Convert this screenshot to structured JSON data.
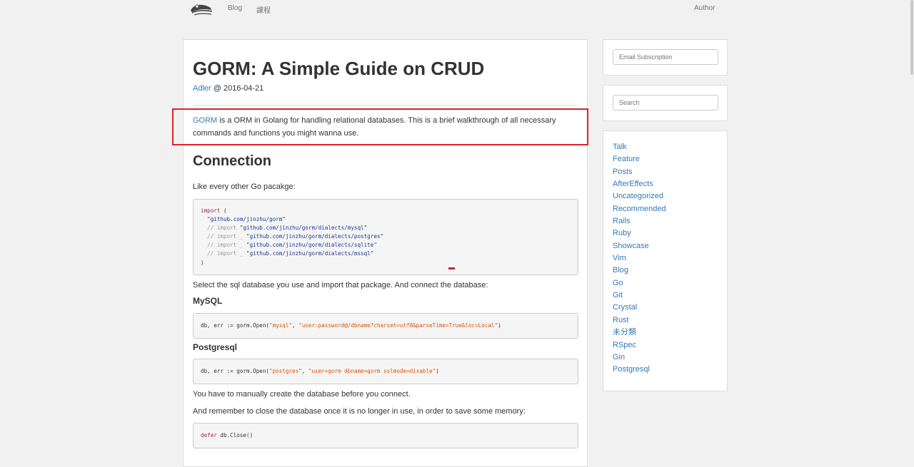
{
  "nav": {
    "logo": "logo-icon",
    "links": [
      "Blog",
      "課程"
    ],
    "author": "Author"
  },
  "post": {
    "title": "GORM: A Simple Guide on CRUD",
    "author": "Adler",
    "date_sep": " @ ",
    "date": "2016-04-21",
    "intro_link": "GORM",
    "intro_text": " is a ORM in Golang for handling relational databases. This is a brief walkthrough of all necessary commands and functions you might wanna use.",
    "sections": {
      "connection_heading": "Connection",
      "like_text": "Like every other Go pacakge:",
      "import_code": {
        "l1_kw": "import",
        "l1_rest": " (",
        "l2": "  \"github.com/jinzhu/gorm\"",
        "l3_cmt": "  // import ",
        "l3_str": "\"github.com/jinzhu/gorm/dialects/mysql\"",
        "l4_cmt": "  // import _ ",
        "l4_str": "\"github.com/jinzhu/gorm/dialects/postgres\"",
        "l5_cmt": "  // import _ ",
        "l5_str": "\"github.com/jinzhu/gorm/dialects/sqlite\"",
        "l6_cmt": "  // import _ ",
        "l6_str": "\"github.com/jinzhu/gorm/dialects/mssql\"",
        "l7": ")"
      },
      "select_text": "Select the sql database you use and import that package. And connect the database:",
      "mysql_heading": "MySQL",
      "mysql_code": {
        "prefix": "db, err := gorm.Open(",
        "arg1": "\"mysql\"",
        "comma": ", ",
        "arg2": "\"user:password@/dbname?charset=utf8&parseTime=True&loc=Local\"",
        "suffix": ")"
      },
      "postgres_heading": "Postgresql",
      "postgres_code": {
        "prefix": "db, err := gorm.Open(",
        "arg1": "\"postgres\"",
        "comma": ", ",
        "arg2": "\"user=gorm dbname=gorm sslmode=disable\"",
        "suffix": ")"
      },
      "manual_text": "You have to manually create the database before you connect.",
      "close_text": "And remember to close the database once it is no longer in use, in order to save some memory:",
      "defer_code": {
        "kw": "defer",
        "rest": " db.Close()"
      }
    }
  },
  "sidebar": {
    "email_placeholder": "Email Subscription",
    "search_placeholder": "Search",
    "categories": [
      "Talk",
      "Feature",
      "Posts",
      "AfterEffects",
      "Uncategorized",
      "Recommended",
      "Rails",
      "Ruby",
      "Showcase",
      "Vim",
      "Blog",
      "Go",
      "Git",
      "Crystal",
      "Rust",
      "未分類",
      "RSpec",
      "Gin",
      "Postgresql"
    ]
  },
  "colors": {
    "link": "#337ab7",
    "highlight": "#d9242b",
    "background": "#f1f1f1"
  }
}
